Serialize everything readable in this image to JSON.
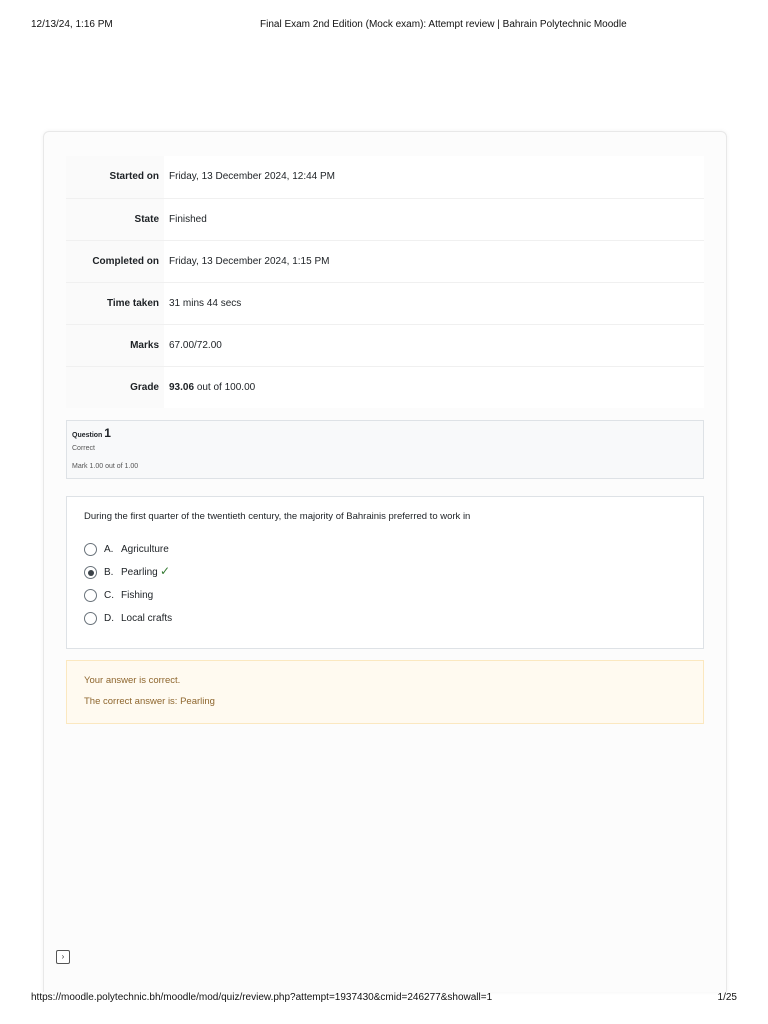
{
  "header": {
    "datetime": "12/13/24, 1:16 PM",
    "title": "Final Exam 2nd Edition (Mock exam): Attempt review | Bahrain Polytechnic Moodle"
  },
  "summary": {
    "rows": [
      {
        "label": "Started on",
        "value": "Friday, 13 December 2024, 12:44 PM"
      },
      {
        "label": "State",
        "value": "Finished"
      },
      {
        "label": "Completed on",
        "value": "Friday, 13 December 2024, 1:15 PM"
      },
      {
        "label": "Time taken",
        "value": "31 mins 44 secs"
      },
      {
        "label": "Marks",
        "value": "67.00/72.00"
      }
    ],
    "grade": {
      "label": "Grade",
      "value": "93.06",
      "suffix": "out of 100.00"
    }
  },
  "question": {
    "label": "Question",
    "number": "1",
    "state": "Correct",
    "mark": "Mark 1.00 out of 1.00",
    "text": "During the first quarter of the twentieth century, the majority of Bahrainis preferred to work in",
    "answers": [
      {
        "letter": "A.",
        "text": "Agriculture",
        "selected": false
      },
      {
        "letter": "B.",
        "text": "Pearling",
        "selected": true
      },
      {
        "letter": "C.",
        "text": "Fishing",
        "selected": false
      },
      {
        "letter": "D.",
        "text": "Local crafts",
        "selected": false
      }
    ],
    "correct_icon": "check-icon",
    "feedback": {
      "result": "Your answer is correct.",
      "correct_answer": "The correct answer is: Pearling"
    }
  },
  "nav": {
    "icon": "chevron-right-icon",
    "glyph": "›"
  },
  "footer": {
    "url": "https://moodle.polytechnic.bh/moodle/mod/quiz/review.php?attempt=1937430&cmid=246277&showall=1",
    "page": "1/25"
  },
  "colors": {
    "correct": "#357a32",
    "feedback_text": "#8e662e",
    "feedback_bg": "#fffaf0"
  }
}
